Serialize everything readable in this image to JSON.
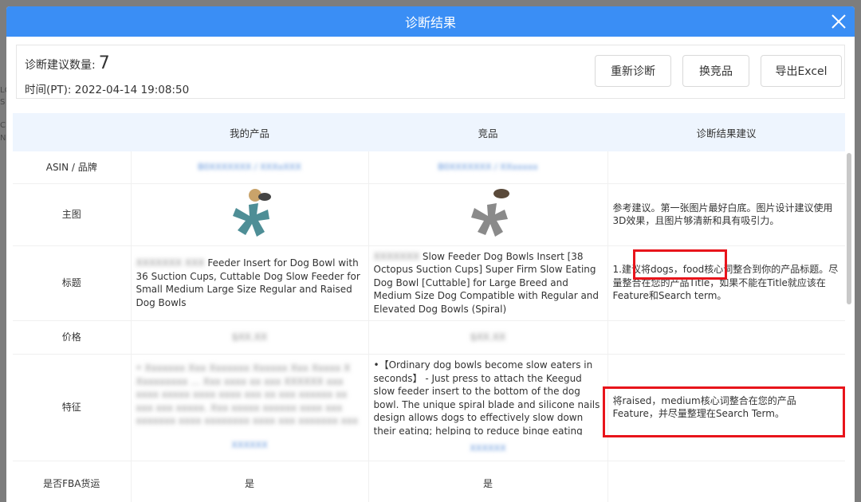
{
  "dialog": {
    "title": "诊断结果",
    "close_icon": "close-icon"
  },
  "summary": {
    "count_label": "诊断建议数量:",
    "count_value": "7",
    "time_label": "时间(PT):",
    "time_value": "2022-04-14 19:08:50"
  },
  "buttons": {
    "rediagnose": "重新诊断",
    "swap_competitor": "换竞品",
    "export_excel": "导出Excel"
  },
  "table": {
    "headers": [
      "",
      "我的产品",
      "竞品",
      "诊断结果建议"
    ],
    "rows": {
      "asin": {
        "label": "ASIN / 品牌",
        "my": "B0XXXXXXX / XXXxXXX",
        "competitor": "B0XXXXXXX / XXxxxxx",
        "advice": ""
      },
      "image": {
        "label": "主图",
        "advice": "参考建议。第一张图片最好白底。图片设计建议使用3D效果，且图片够清新和具有吸引力。"
      },
      "title": {
        "label": "标题",
        "my_blur": "XXXXXXX XXX",
        "my": "Feeder Insert for Dog Bowl with 36 Suction Cups, Cuttable Dog Slow Feeder for Small Medium Large Size Regular and Raised Dog Bowls",
        "competitor_blur": "XXXXXXX",
        "competitor": "Slow Feeder Dog Bowls Insert [38 Octopus Suction Cups] Super Firm Slow Eating Dog Bowl [Cuttable] for Large Breed and Medium Size Dog Compatible with Regular and Elevated Dog Bowls (Spiral)",
        "advice": "1.建议将dogs，food核心词整合到你的产品标题。尽量整合在您的产品Title，如果不能在Title就应该在Feature和Search term。"
      },
      "price": {
        "label": "价格",
        "my": "$XX.XX",
        "competitor": "$XX.XX",
        "advice": ""
      },
      "feature": {
        "label": "特征",
        "my_blur": "• Xxxxxxx Xxx Xxxxxxx Xxxxxx Xxx Xxxxx X Xxxxxxxxx ... Xxx xxxx xx xxx XXXXXX xxx xxxx xxxxx xxxx xxxx xxx xx xxx xxxxxx xx xxx xxx xxxxx. Xxx xxxxx xxxxxx xxxx xxx xxxxxxx xxxx xxxxxxxx xxxx xxx xxxxxxx xxx xxxx xxxx xxxx xxxxxx xx xxxxxx xxxxx xxxxxx xxx xxxxxxxx xxxxxx x xxxx...",
        "my_link": "XXXXXX",
        "competitor": "•【Ordinary dog bowls become slow eaters in seconds】 - Just press to attach the Keegud slow feeder insert to the bottom of the dog bowl. The unique spiral blade and silicone nails design allows dogs to effectively slow down their eating; helping to reduce binge eating and reducing digestive disease i...",
        "competitor_link": "XXXXXX",
        "advice": "将raised，medium核心词整合在您的产品Feature，并尽量整理在Search Term。"
      },
      "fba": {
        "label": "是否FBA货运",
        "my": "是",
        "competitor": "是",
        "advice": ""
      }
    }
  },
  "colors": {
    "header_blue": "#3a8ef5",
    "table_header_bg": "#eef5fe",
    "highlight_red": "#e8141b"
  }
}
